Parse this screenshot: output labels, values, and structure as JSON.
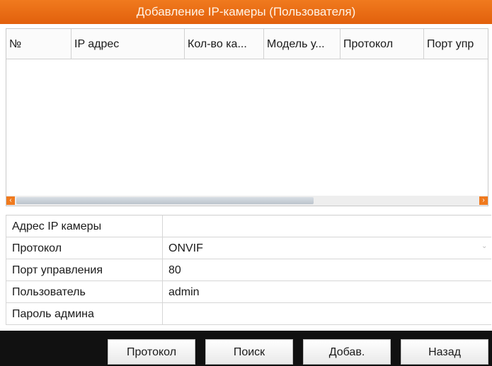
{
  "window": {
    "title": "Добавление IP-камеры (Пользователя)"
  },
  "table": {
    "columns": [
      "№",
      "IP адрес",
      "Кол-во ка...",
      "Модель у...",
      "Протокол",
      "Порт упр"
    ],
    "rows": []
  },
  "form": {
    "fields": [
      {
        "label": "Адрес IP камеры",
        "value": ""
      },
      {
        "label": "Протокол",
        "value": "ONVIF"
      },
      {
        "label": "Порт управления",
        "value": "80"
      },
      {
        "label": "Пользователь",
        "value": "admin"
      },
      {
        "label": "Пароль админа",
        "value": ""
      }
    ]
  },
  "buttons": {
    "protocol": "Протокол",
    "search": "Поиск",
    "add": "Добав.",
    "back": "Назад"
  },
  "colors": {
    "accent": "#E8660F",
    "footer": "#111111"
  }
}
